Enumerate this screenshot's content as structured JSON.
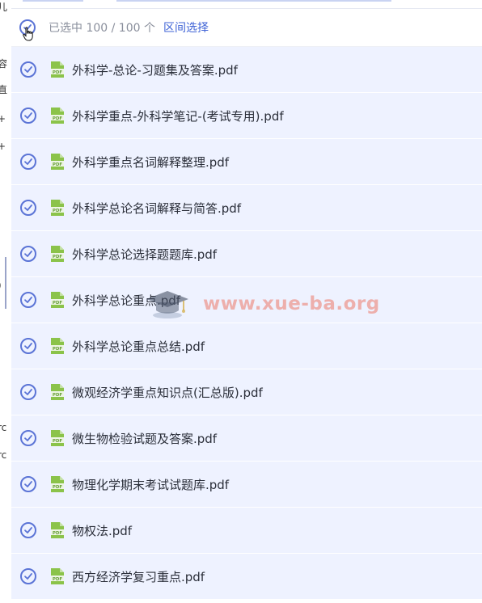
{
  "header": {
    "selection_count": "已选中 100 / 100 个",
    "range_select_label": "区间选择"
  },
  "left_fragments": [
    "儿",
    "容",
    "直",
    "+",
    "+",
    ")",
    "rc",
    "rc"
  ],
  "watermark": "www.xue-ba.org",
  "files": [
    {
      "name": "外科学-总论-习题集及答案.pdf"
    },
    {
      "name": "外科学重点-外科学笔记-(考试专用).pdf"
    },
    {
      "name": "外科学重点名词解释整理.pdf"
    },
    {
      "name": "外科学总论名词解释与简答.pdf"
    },
    {
      "name": "外科学总论选择题题库.pdf"
    },
    {
      "name": "外科学总论重点.pdf"
    },
    {
      "name": "外科学总论重点总结.pdf"
    },
    {
      "name": "微观经济学重点知识点(汇总版).pdf"
    },
    {
      "name": "微生物检验试题及答案.pdf"
    },
    {
      "name": "物理化学期末考试试题库.pdf"
    },
    {
      "name": "物权法.pdf"
    },
    {
      "name": "西方经济学复习重点.pdf"
    }
  ],
  "colors": {
    "accent": "#5b74d6",
    "row_bg": "#eef2ff",
    "pdf_green": "#8bc34a",
    "link": "#3f63d6"
  }
}
